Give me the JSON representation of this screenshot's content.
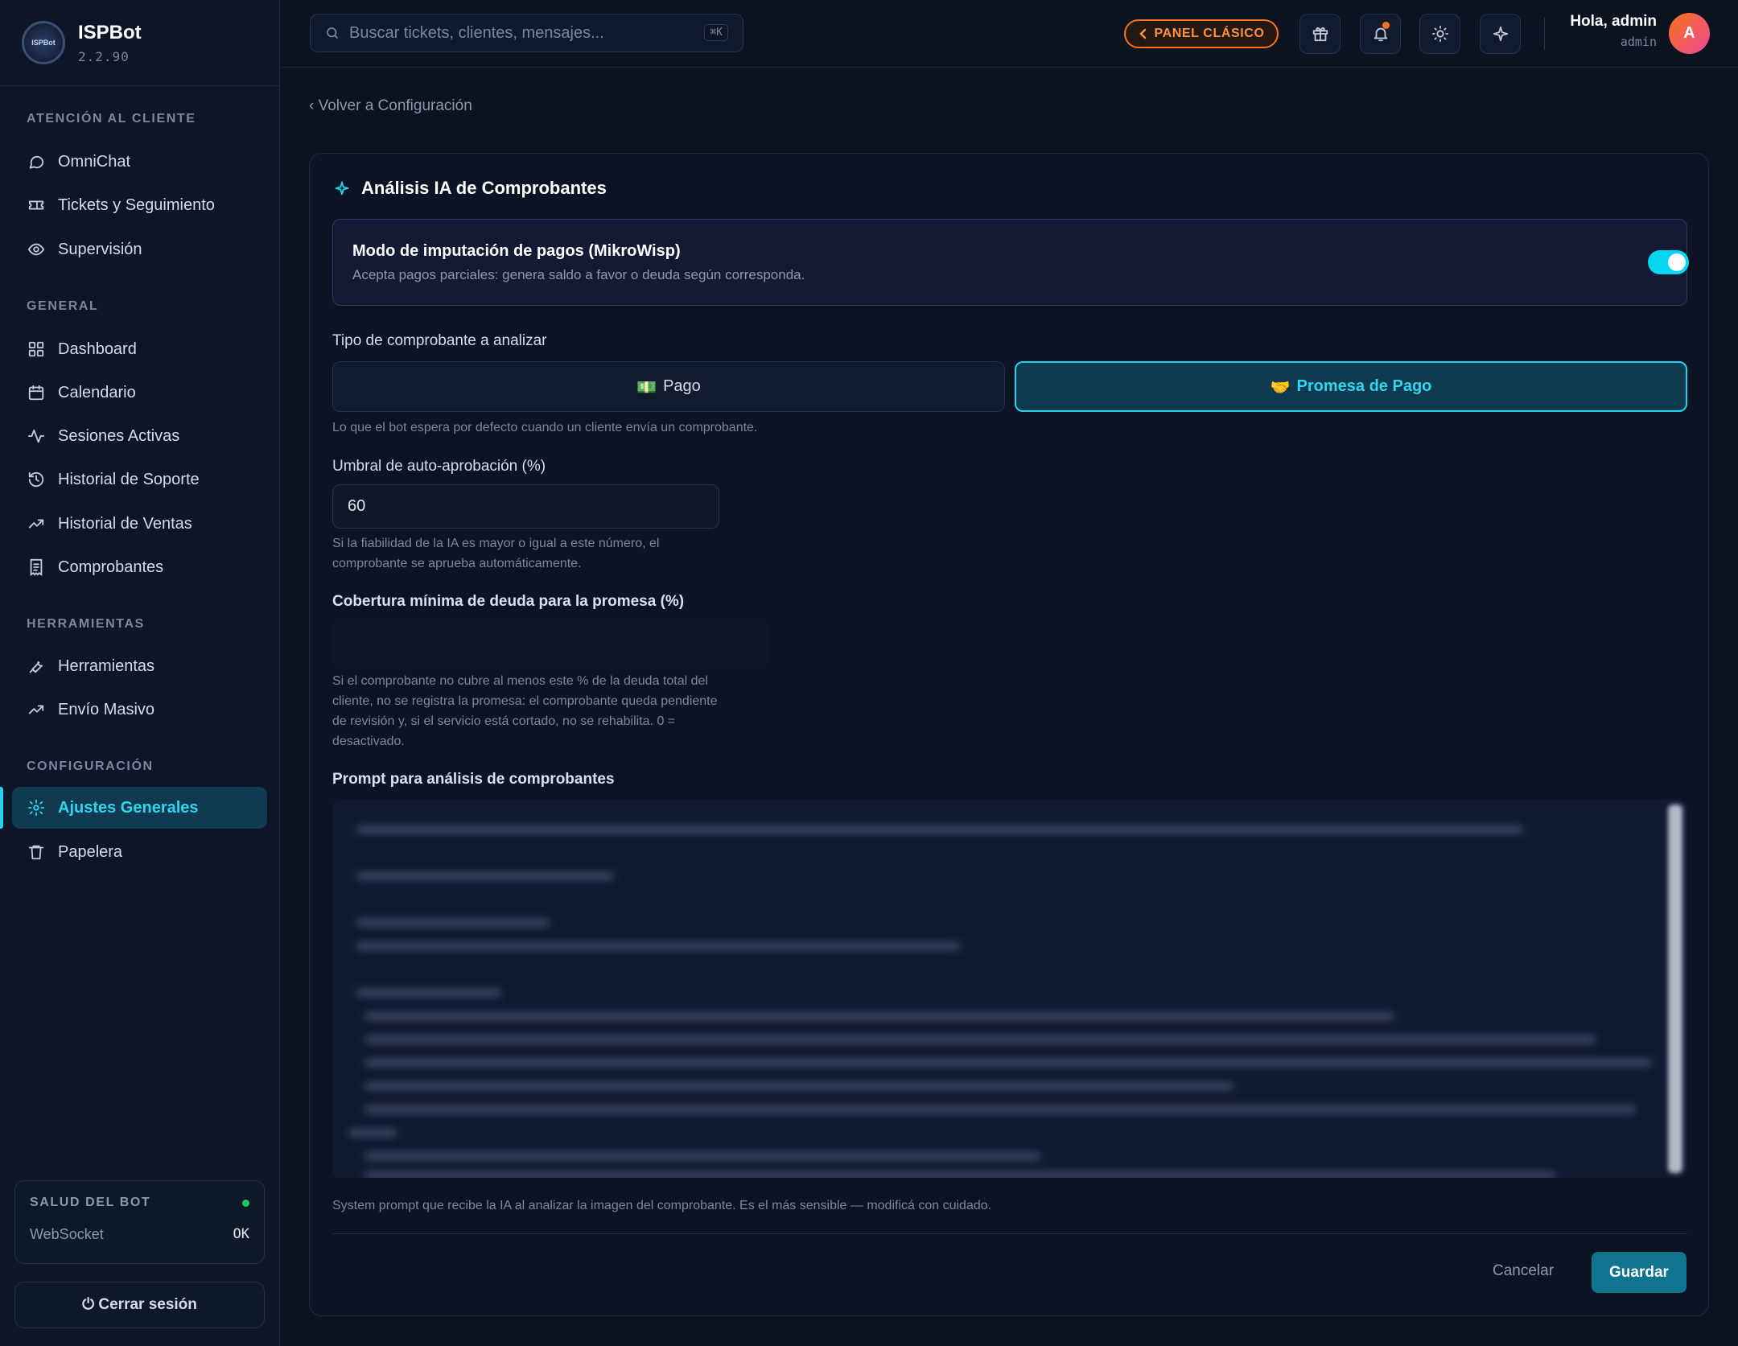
{
  "app": {
    "name": "ISPBot",
    "version": "2.2.90",
    "logo_text": "ISPBot"
  },
  "sidebar": {
    "sections": [
      {
        "label": "ATENCIÓN AL CLIENTE",
        "items": [
          {
            "label": "OmniChat",
            "icon": "chat-bubble-icon"
          },
          {
            "label": "Tickets y Seguimiento",
            "icon": "ticket-icon"
          },
          {
            "label": "Supervisión",
            "icon": "eye-icon"
          }
        ]
      },
      {
        "label": "GENERAL",
        "items": [
          {
            "label": "Dashboard",
            "icon": "grid-icon"
          },
          {
            "label": "Calendario",
            "icon": "calendar-icon"
          },
          {
            "label": "Sesiones Activas",
            "icon": "activity-icon"
          },
          {
            "label": "Historial de Soporte",
            "icon": "history-icon"
          },
          {
            "label": "Historial de Ventas",
            "icon": "trending-up-icon"
          },
          {
            "label": "Comprobantes",
            "icon": "receipt-icon"
          }
        ]
      },
      {
        "label": "HERRAMIENTAS",
        "items": [
          {
            "label": "Herramientas",
            "icon": "wrench-icon"
          },
          {
            "label": "Envío Masivo",
            "icon": "trending-up-icon"
          }
        ]
      },
      {
        "label": "CONFIGURACIÓN",
        "items": [
          {
            "label": "Ajustes Generales",
            "icon": "gear-icon",
            "active": true
          },
          {
            "label": "Papelera",
            "icon": "trash-icon"
          }
        ]
      }
    ],
    "health": {
      "title": "SALUD DEL BOT",
      "row_label": "WebSocket",
      "row_value": "OK"
    },
    "logout_label": "⏻ Cerrar sesión"
  },
  "topbar": {
    "search_placeholder": "Buscar tickets, clientes, mensajes...",
    "search_shortcut": "⌘K",
    "classic_panel_label": "PANEL CLÁSICO",
    "greeting": "Hola, admin",
    "role": "admin",
    "avatar_initial": "A"
  },
  "main": {
    "back_link": "‹ Volver a Configuración",
    "card_title": "Análisis IA de Comprobantes",
    "mode": {
      "title": "Modo de imputación de pagos (MikroWisp)",
      "description": "Acepta pagos parciales: genera saldo a favor o deuda según corresponda.",
      "enabled": true
    },
    "receipt_type": {
      "label": "Tipo de comprobante a analizar",
      "options": [
        {
          "emoji": "💵",
          "label": "Pago",
          "selected": false
        },
        {
          "emoji": "🤝",
          "label": "Promesa de Pago",
          "selected": true
        }
      ],
      "hint": "Lo que el bot espera por defecto cuando un cliente envía un comprobante."
    },
    "threshold": {
      "label": "Umbral de auto-aprobación (%)",
      "value": "60",
      "hint_line1": "Si la fiabilidad de la IA es mayor o igual a este número, el",
      "hint_line2": "comprobante se aprueba automáticamente."
    },
    "coverage": {
      "label": "Cobertura mínima de deuda para la promesa (%)",
      "value": "",
      "hint_line1": "Si el comprobante no cubre al menos este % de la deuda total del",
      "hint_line2": "cliente, no se registra la promesa: el comprobante queda pendiente",
      "hint_line3": "de revisión y, si el servicio está cortado, no se rehabilita. 0 =",
      "hint_line4": "desactivado."
    },
    "prompt": {
      "label": "Prompt para análisis de comprobantes",
      "hint": "System prompt que recibe la IA al analizar la imagen del comprobante. Es el más sensible — modificá con cuidado."
    },
    "actions": {
      "cancel": "Cancelar",
      "save": "Guardar"
    }
  },
  "colors": {
    "accent": "#22d3ee",
    "orange": "#f97316",
    "background": "#0b1220",
    "sidebar": "#0d1526"
  }
}
